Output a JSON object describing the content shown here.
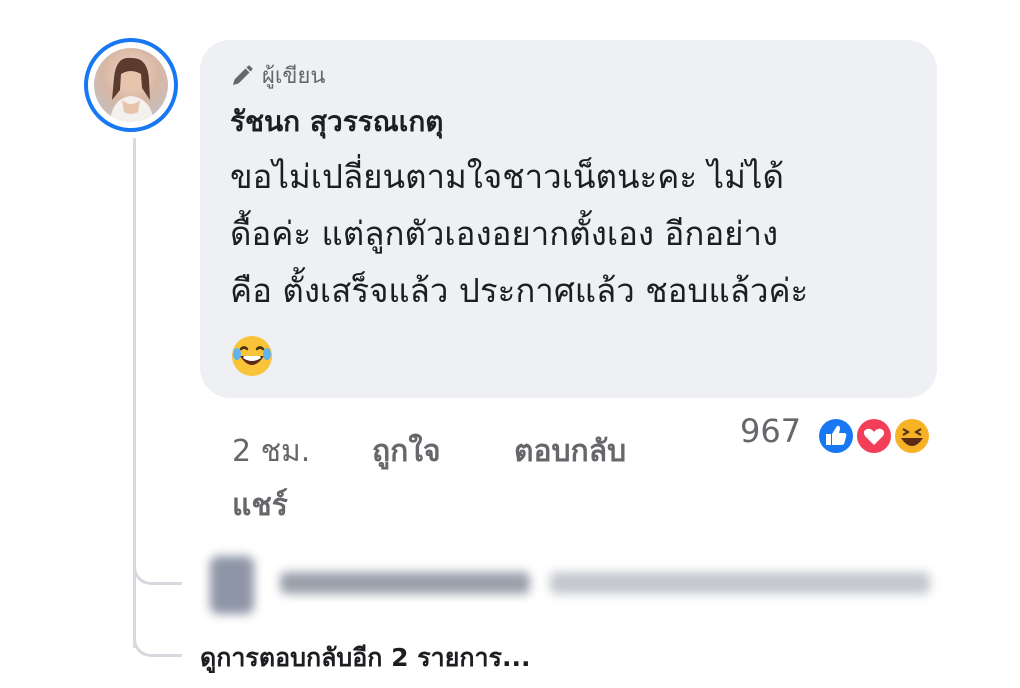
{
  "comment": {
    "badge_label": "ผู้เขียน",
    "badge_icon": "pencil-icon",
    "author": "รัชนก สุวรรณเกตุ",
    "text_lines": [
      "ขอไม่เปลี่ยนตามใจชาวเน็ตนะคะ ไม่ได้",
      "ดื้อค่ะ แต่ลูกตัวเองอยากตั้งเอง อีกอย่าง",
      "คือ ตั้งเสร็จแล้ว ประกาศแล้ว ชอบแล้วค่ะ"
    ],
    "emoji": "laughing-tears-emoji"
  },
  "actions": {
    "time": "2 ชม.",
    "like": "ถูกใจ",
    "reply": "ตอบกลับ",
    "share": "แชร์"
  },
  "reactions": {
    "count": "967",
    "icons": [
      "like-reaction-icon",
      "love-reaction-icon",
      "haha-reaction-icon"
    ],
    "colors": {
      "like": "#1877f2",
      "love": "#f33e58",
      "haha": "#f7b125"
    }
  },
  "replies": {
    "view_more": "ดูการตอบกลับอีก 2 รายการ..."
  },
  "colors": {
    "bubble": "#eef0f4",
    "avatar_ring": "#1877f2",
    "secondary_text": "#65676b"
  }
}
